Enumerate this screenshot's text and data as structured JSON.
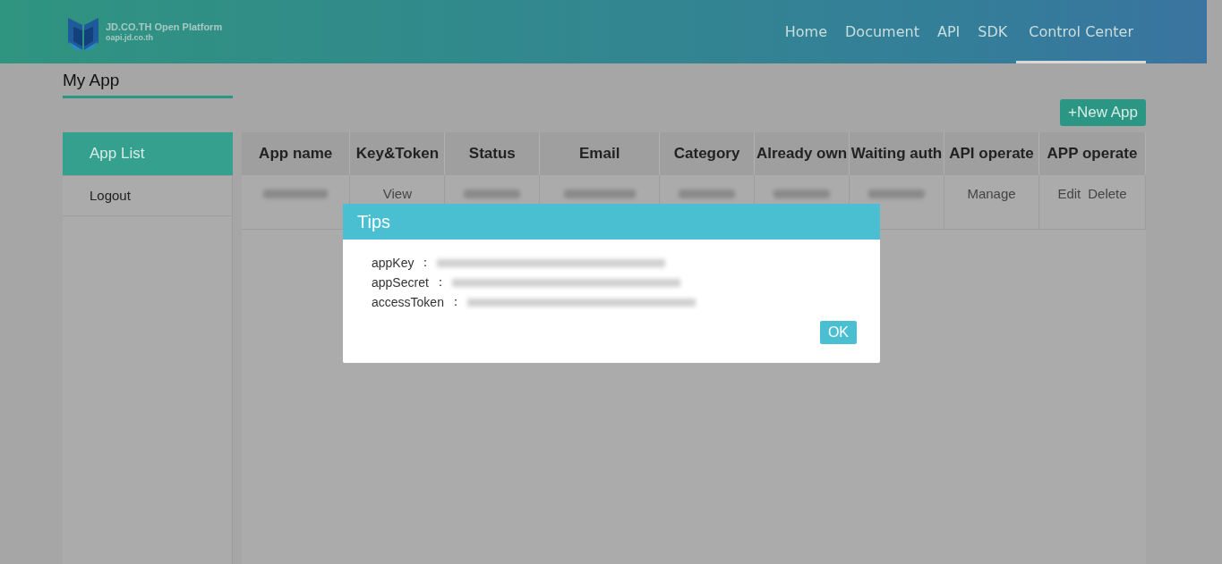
{
  "header": {
    "logo_title": "JD.CO.TH Open Platform",
    "logo_subtitle": "oapi.jd.co.th",
    "nav": [
      {
        "label": "Home",
        "selected": false
      },
      {
        "label": "Document",
        "selected": false
      },
      {
        "label": "API",
        "selected": false
      },
      {
        "label": "SDK",
        "selected": false
      },
      {
        "label": "Control Center",
        "selected": true
      }
    ]
  },
  "page_title": "My App",
  "new_app_button": "+New App",
  "sidebar": {
    "items": [
      {
        "label": "App List",
        "selected": true
      },
      {
        "label": "Logout",
        "selected": false
      }
    ]
  },
  "table": {
    "columns": [
      "App name",
      "Key&Token",
      "Status",
      "Email",
      "Category",
      "Already own",
      "Waiting auth",
      "API operate",
      "APP operate"
    ],
    "rows": [
      {
        "cells": [
          {
            "kind": "redacted"
          },
          {
            "kind": "link",
            "text": "View"
          },
          {
            "kind": "redacted"
          },
          {
            "kind": "redacted"
          },
          {
            "kind": "redacted"
          },
          {
            "kind": "redacted"
          },
          {
            "kind": "redacted"
          },
          {
            "kind": "link",
            "text": "Manage"
          },
          {
            "kind": "links",
            "links": [
              "Edit",
              "Delete"
            ]
          }
        ]
      }
    ]
  },
  "dialog": {
    "title": "Tips",
    "fields": [
      {
        "label": "appKey",
        "separator": "："
      },
      {
        "label": "appSecret",
        "separator": "："
      },
      {
        "label": "accessToken",
        "separator": "："
      }
    ],
    "button": "OK"
  }
}
